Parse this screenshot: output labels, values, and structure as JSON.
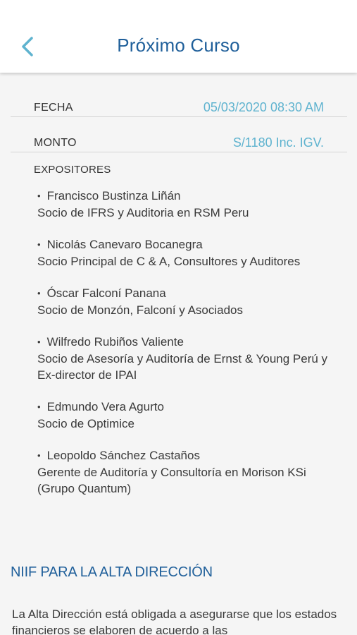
{
  "header": {
    "title": "Próximo Curso",
    "back_icon": "chevron-left-icon",
    "accent_color": "#5fb3cf",
    "title_color": "#1f5f9a"
  },
  "info": {
    "fecha_label": "FECHA",
    "fecha_value": "05/03/2020 08:30 AM",
    "monto_label": "MONTO",
    "monto_value": "S/1180 Inc. IGV."
  },
  "expositores": {
    "label": "EXPOSITORES",
    "items": [
      {
        "name": "Francisco Bustinza Liñán",
        "role": "Socio de IFRS y Auditoria en RSM Peru"
      },
      {
        "name": "Nicolás Canevaro Bocanegra",
        "role": "Socio Principal de C & A, Consultores y Auditores"
      },
      {
        "name": "Óscar Falconí Panana",
        "role": "Socio de Monzón, Falconí y Asociados"
      },
      {
        "name": "Wilfredo Rubiños Valiente",
        "role": "Socio de Asesoría y Auditoría de Ernst & Young Perú y Ex-director de IPAI"
      },
      {
        "name": "Edmundo Vera Agurto",
        "role": "Socio de Optimice"
      },
      {
        "name": "Leopoldo Sánchez Castaños",
        "role": "Gerente de Auditoría y Consultoría en Morison KSi (Grupo Quantum)"
      }
    ]
  },
  "section": {
    "title": "NIIF PARA LA ALTA DIRECCIÓN",
    "body": "La Alta Dirección está obligada a asegurarse que los estados financieros se elaboren de acuerdo a las"
  }
}
